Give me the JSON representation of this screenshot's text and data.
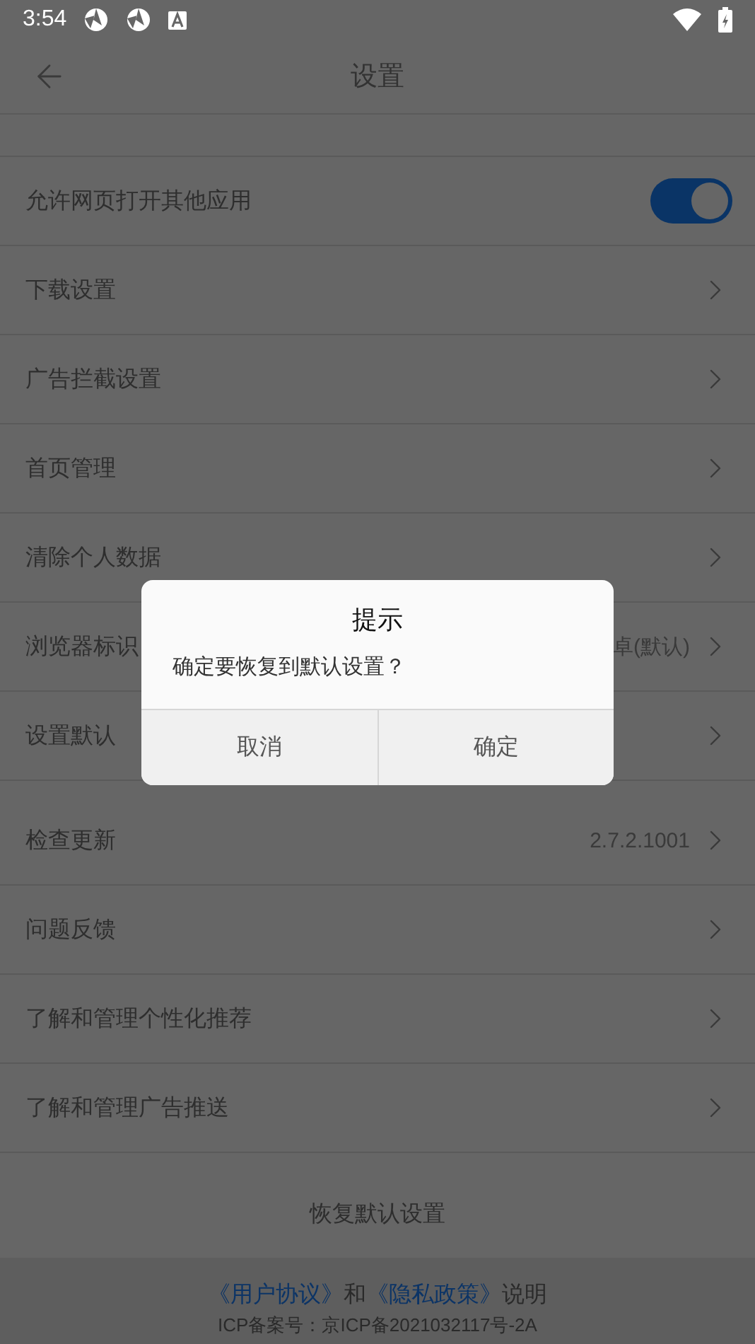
{
  "status_bar": {
    "time": "3:54"
  },
  "header": {
    "title": "设置"
  },
  "sections": [
    {
      "rows": [
        {
          "kind": "toggle",
          "label": "允许网页打开其他应用",
          "on": true
        },
        {
          "kind": "link",
          "label": "下载设置"
        },
        {
          "kind": "link",
          "label": "广告拦截设置"
        },
        {
          "kind": "link",
          "label": "首页管理"
        },
        {
          "kind": "link",
          "label": "清除个人数据"
        },
        {
          "kind": "link",
          "label": "浏览器标识",
          "value": "卓(默认)"
        },
        {
          "kind": "link",
          "label": "设置默认"
        }
      ]
    },
    {
      "rows": [
        {
          "kind": "link",
          "label": "检查更新",
          "value": "2.7.2.1001"
        },
        {
          "kind": "link",
          "label": "问题反馈"
        },
        {
          "kind": "link",
          "label": "了解和管理个性化推荐"
        },
        {
          "kind": "link",
          "label": "了解和管理广告推送"
        }
      ]
    }
  ],
  "reset_button": "恢复默认设置",
  "footer": {
    "parts": [
      {
        "kind": "link",
        "text": "《用户协议》"
      },
      {
        "kind": "text",
        "text": "和"
      },
      {
        "kind": "link",
        "text": "《隐私政策》"
      },
      {
        "kind": "text",
        "text": "说明"
      }
    ],
    "icp": "ICP备案号：京ICP备2021032117号-2A"
  },
  "dialog": {
    "title": "提示",
    "message": "确定要恢复到默认设置？",
    "buttons": [
      "取消",
      "确定"
    ]
  }
}
